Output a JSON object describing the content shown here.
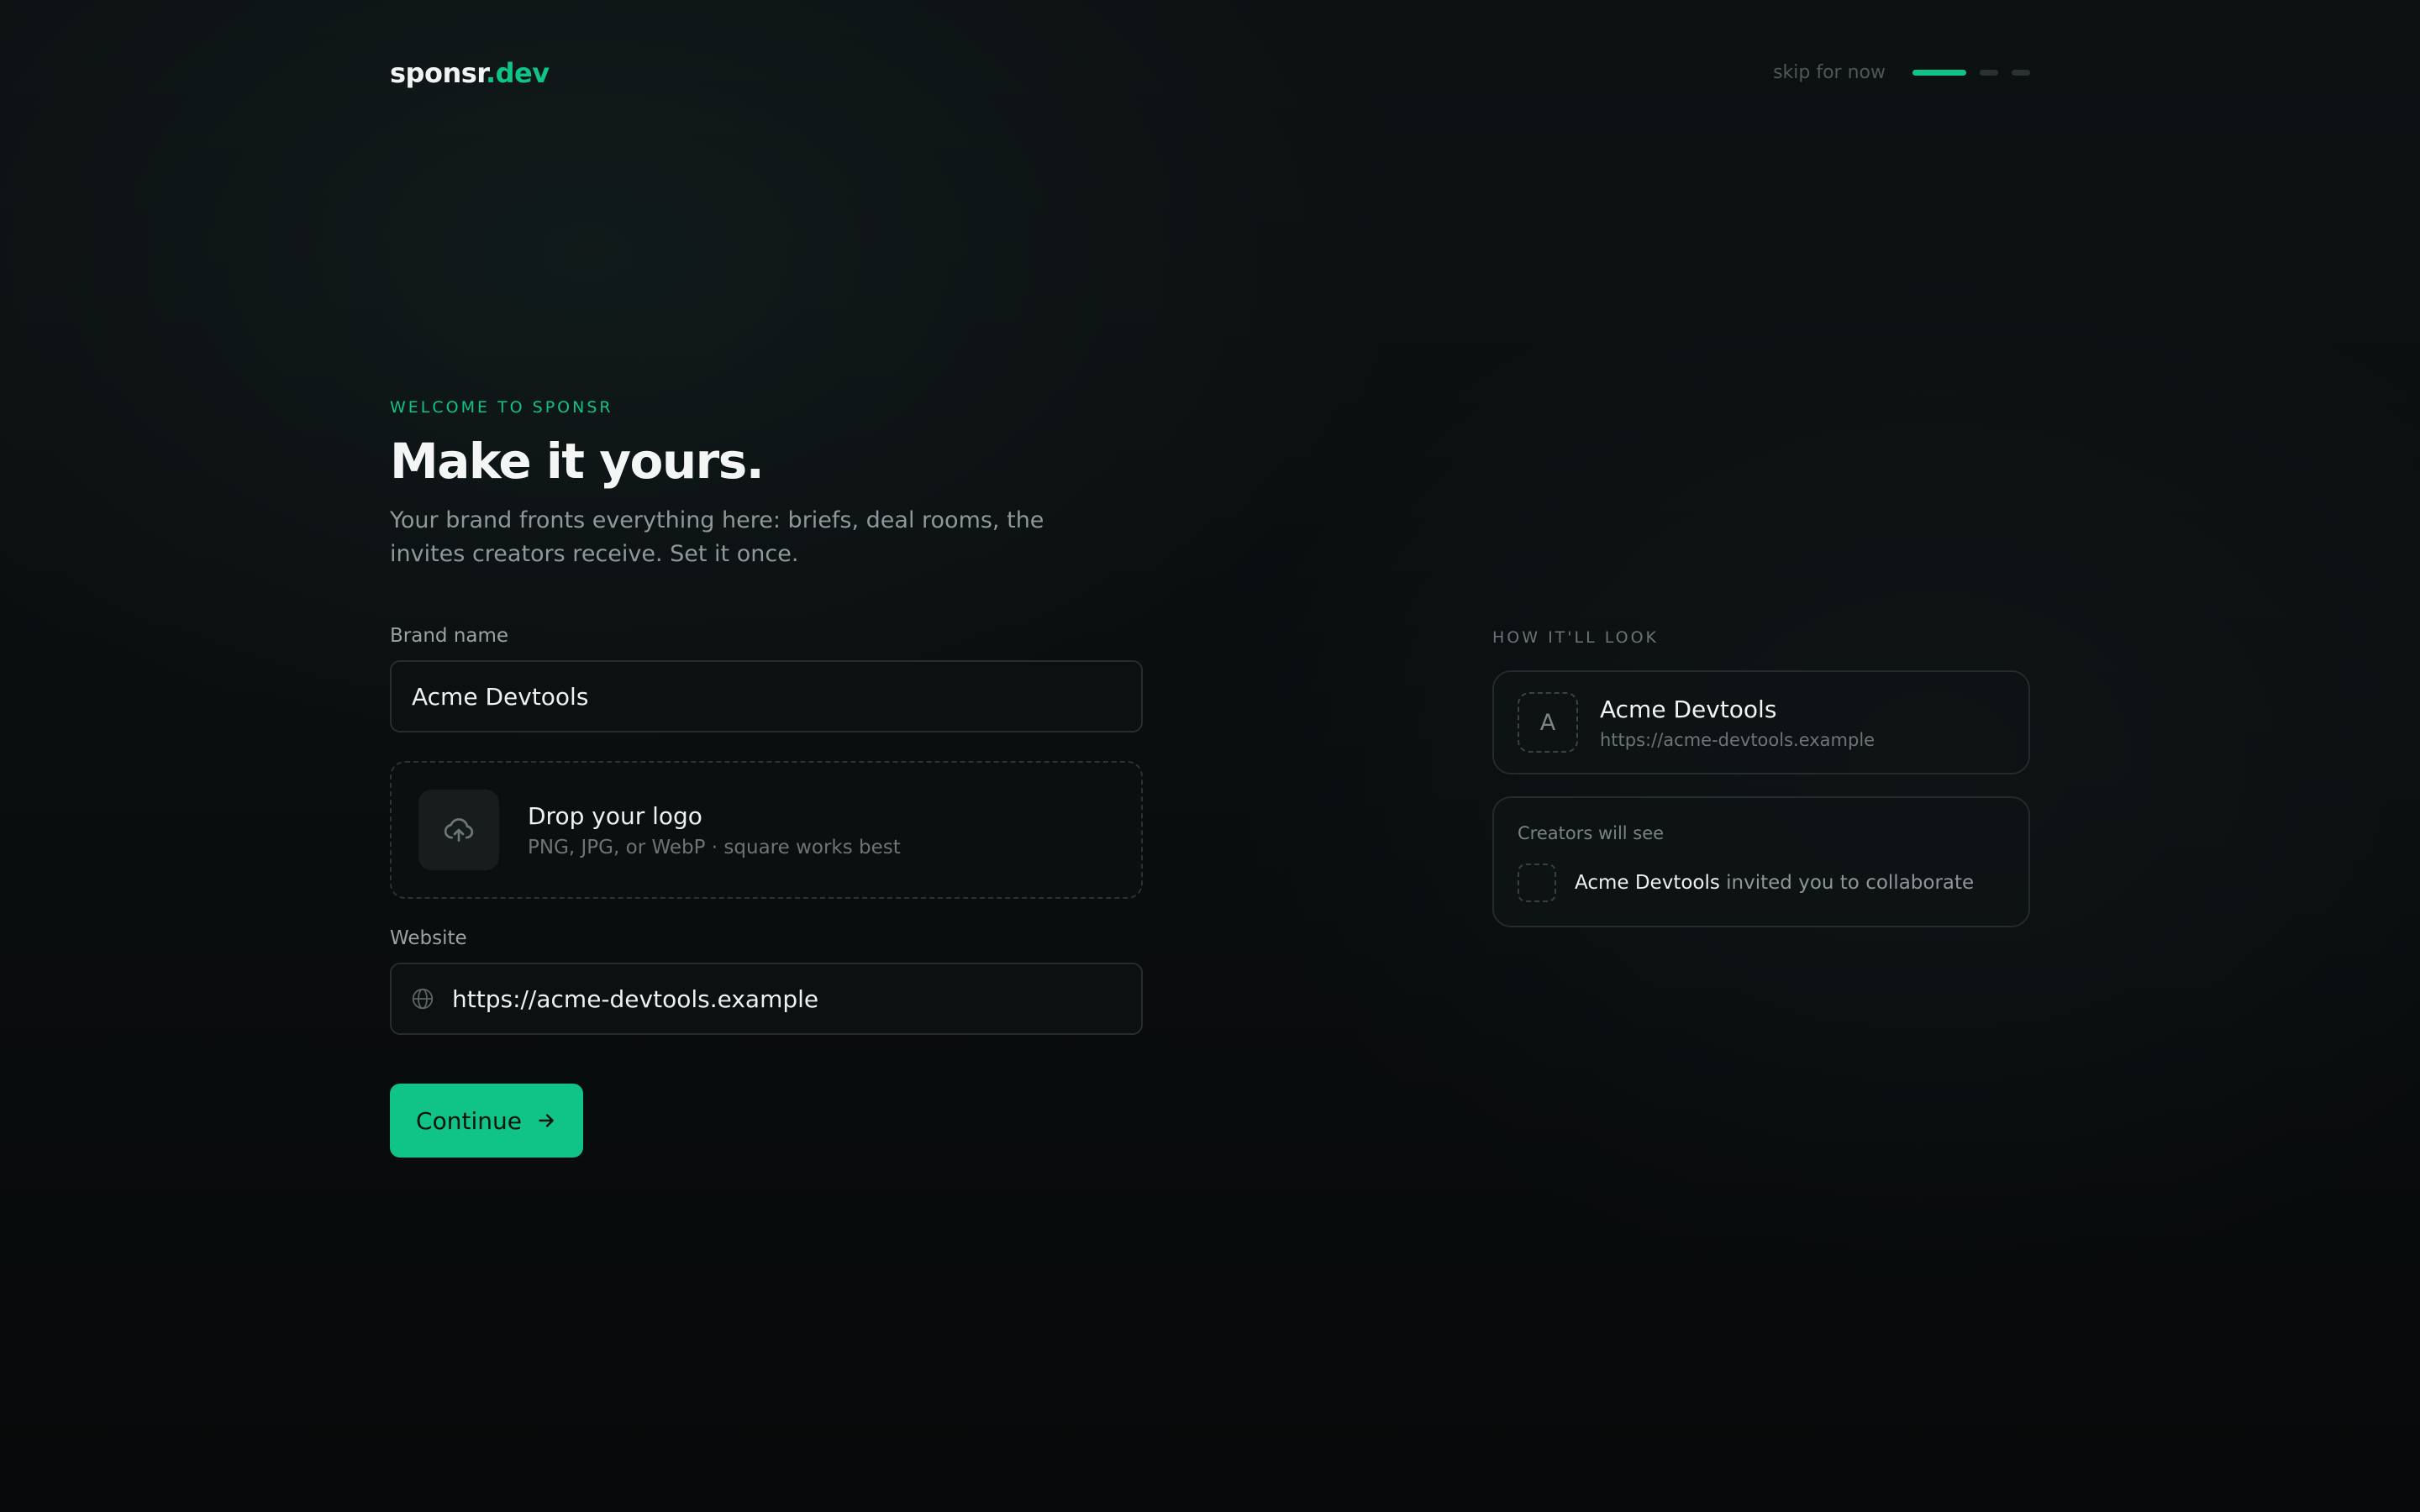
{
  "brand": {
    "name": "sponsr",
    "suffix": ".dev"
  },
  "header": {
    "skip_label": "skip for now",
    "steps": [
      {
        "state": "active"
      },
      {
        "state": "idle"
      },
      {
        "state": "idle"
      }
    ]
  },
  "intro": {
    "eyebrow": "WELCOME TO SPONSR",
    "title": "Make it yours.",
    "subtitle": "Your brand fronts everything here: briefs, deal rooms, the invites creators receive. Set it once."
  },
  "form": {
    "brand_name_label": "Brand name",
    "brand_name_value": "Acme Devtools",
    "logo_drop": {
      "title": "Drop your logo",
      "hint": "PNG, JPG, or WebP · square works best",
      "icon": "upload-cloud-icon"
    },
    "website_label": "Website",
    "website_value": "https://acme-devtools.example",
    "website_icon": "globe-icon",
    "continue_label": "Continue"
  },
  "preview": {
    "label": "HOW IT'LL LOOK",
    "card": {
      "avatar_letter": "A",
      "name": "Acme Devtools",
      "url": "https://acme-devtools.example"
    },
    "invite": {
      "label": "Creators will see",
      "brand": "Acme Devtools",
      "message": " invited you to collaborate"
    }
  },
  "colors": {
    "accent": "#10c386",
    "background": "#0a0d0e",
    "border": "#262d2e",
    "muted_text": "#8f9899"
  }
}
